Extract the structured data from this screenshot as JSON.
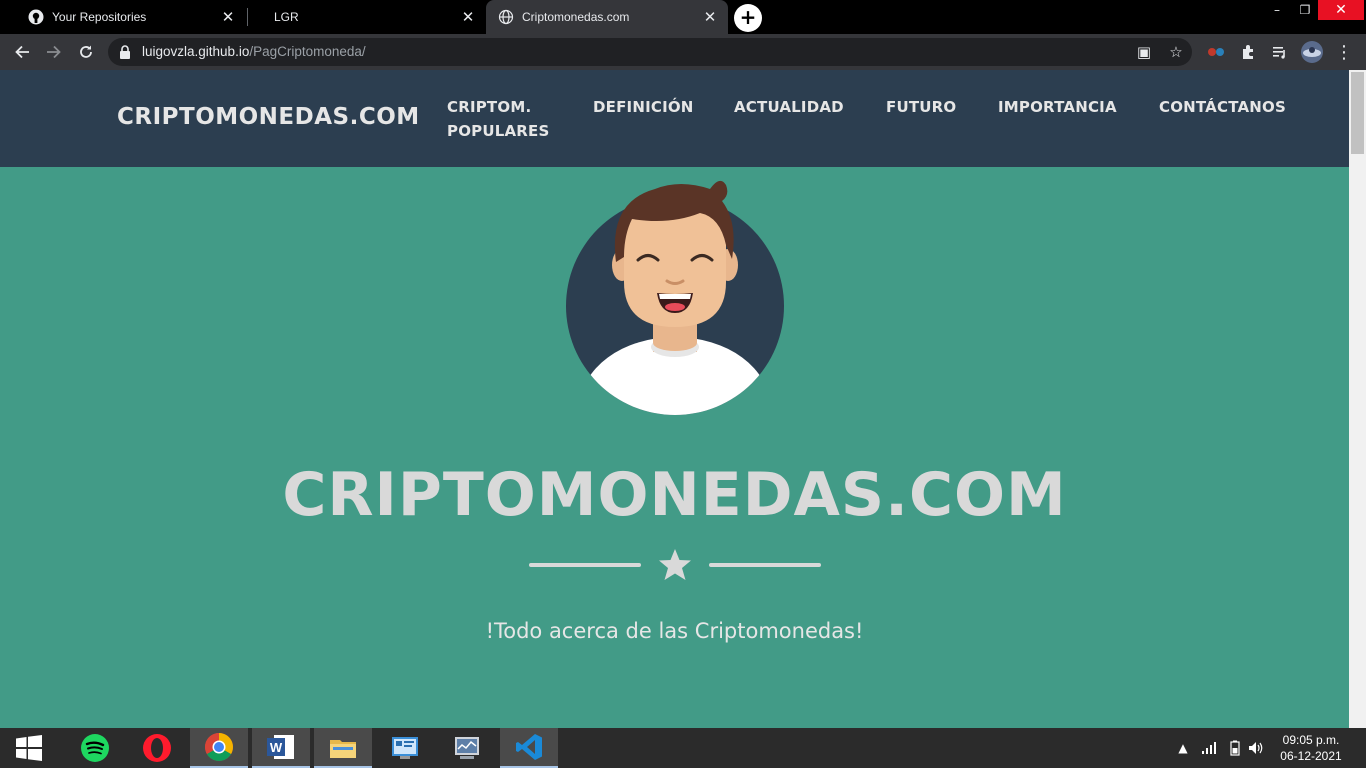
{
  "browser": {
    "tabs": [
      {
        "title": "Your Repositories",
        "icon": "github-icon"
      },
      {
        "title": "LGR",
        "icon": "none"
      },
      {
        "title": "Criptomonedas.com",
        "icon": "globe-icon",
        "active": true
      }
    ],
    "url_host": "luigovzla.github.io",
    "url_path": "/PagCriptomoneda/"
  },
  "site": {
    "brand": "CRIPTOMONEDAS.COM",
    "nav": [
      {
        "line1": "CRIPTOM.",
        "line2": "POPULARES"
      },
      {
        "line1": "DEFINICIÓN"
      },
      {
        "line1": "ACTUALIDAD"
      },
      {
        "line1": "FUTURO"
      },
      {
        "line1": "IMPORTANCIA"
      },
      {
        "line1": "CONTÁCTANOS"
      }
    ],
    "hero_title": "CRIPTOMONEDAS.COM",
    "subtitle": "!Todo acerca de las Criptomonedas!"
  },
  "taskbar": {
    "apps": [
      "start-icon",
      "spotify-icon",
      "opera-icon",
      "chrome-icon",
      "word-icon",
      "file-explorer-icon",
      "control-panel-icon",
      "system-monitor-icon",
      "vscode-icon"
    ],
    "time": "09:05 p.m.",
    "date": "06-12-2021"
  },
  "colors": {
    "navbar": "#2c3e50",
    "page_bg": "#429b87",
    "text_light": "#e6e6e6"
  }
}
